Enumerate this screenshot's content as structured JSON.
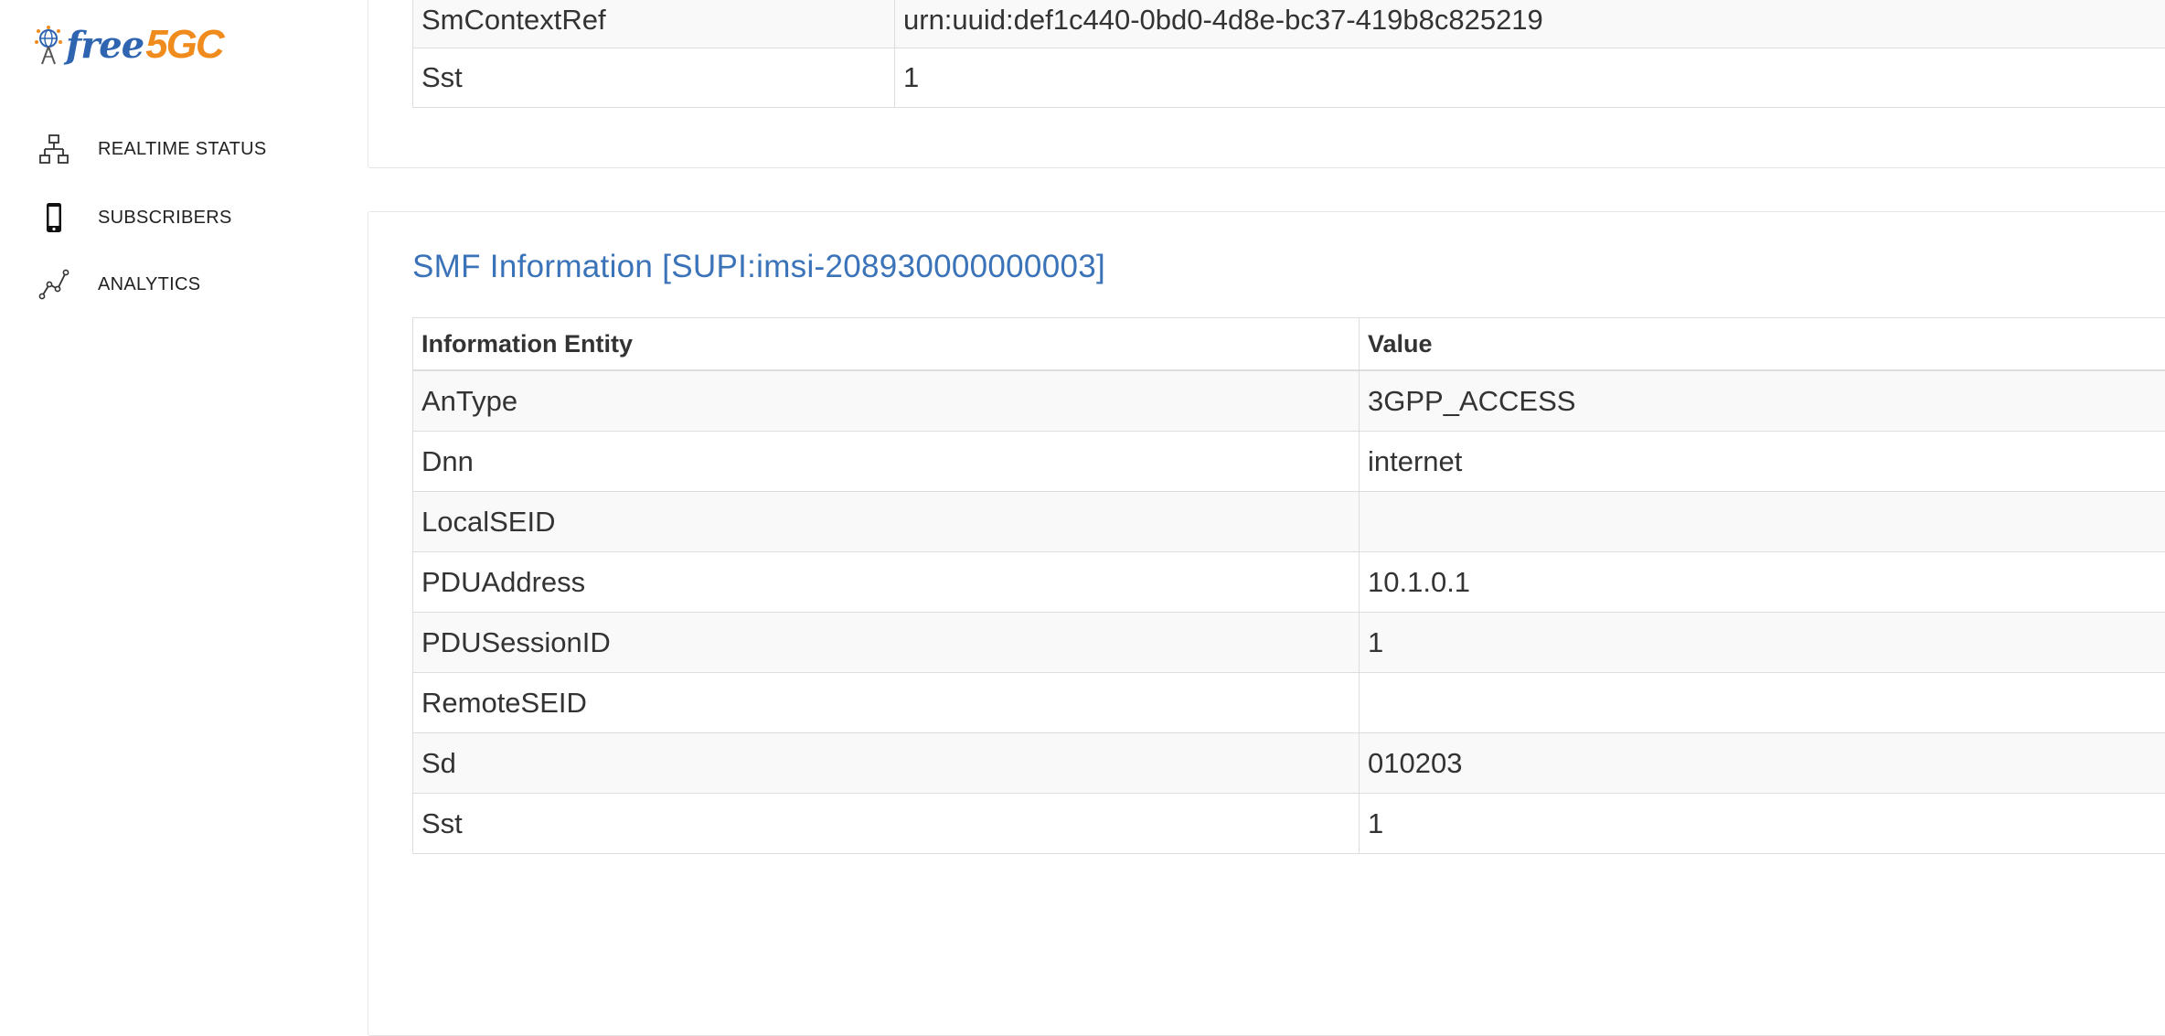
{
  "sidebar": {
    "logo": {
      "text_free": "free",
      "text_5gc": "5GC"
    },
    "items": [
      {
        "label": "REALTIME STATUS",
        "icon": "network-hierarchy-icon"
      },
      {
        "label": "SUBSCRIBERS",
        "icon": "mobile-phone-icon"
      },
      {
        "label": "ANALYTICS",
        "icon": "line-chart-icon"
      }
    ]
  },
  "top_table": {
    "rows": [
      {
        "entity": "SmContextRef",
        "value": "urn:uuid:def1c440-0bd0-4d8e-bc37-419b8c825219"
      },
      {
        "entity": "Sst",
        "value": "1"
      }
    ]
  },
  "smf_card": {
    "title": "SMF Information [SUPI:imsi-208930000000003]",
    "headers": {
      "entity": "Information Entity",
      "value": "Value"
    },
    "rows": [
      {
        "entity": "AnType",
        "value": "3GPP_ACCESS"
      },
      {
        "entity": "Dnn",
        "value": "internet"
      },
      {
        "entity": "LocalSEID",
        "value": ""
      },
      {
        "entity": "PDUAddress",
        "value": "10.1.0.1"
      },
      {
        "entity": "PDUSessionID",
        "value": "1"
      },
      {
        "entity": "RemoteSEID",
        "value": ""
      },
      {
        "entity": "Sd",
        "value": "010203"
      },
      {
        "entity": "Sst",
        "value": "1"
      }
    ]
  },
  "colors": {
    "title_blue": "#3b73b9",
    "logo_blue": "#2e64b0",
    "logo_orange": "#f08c1e"
  }
}
